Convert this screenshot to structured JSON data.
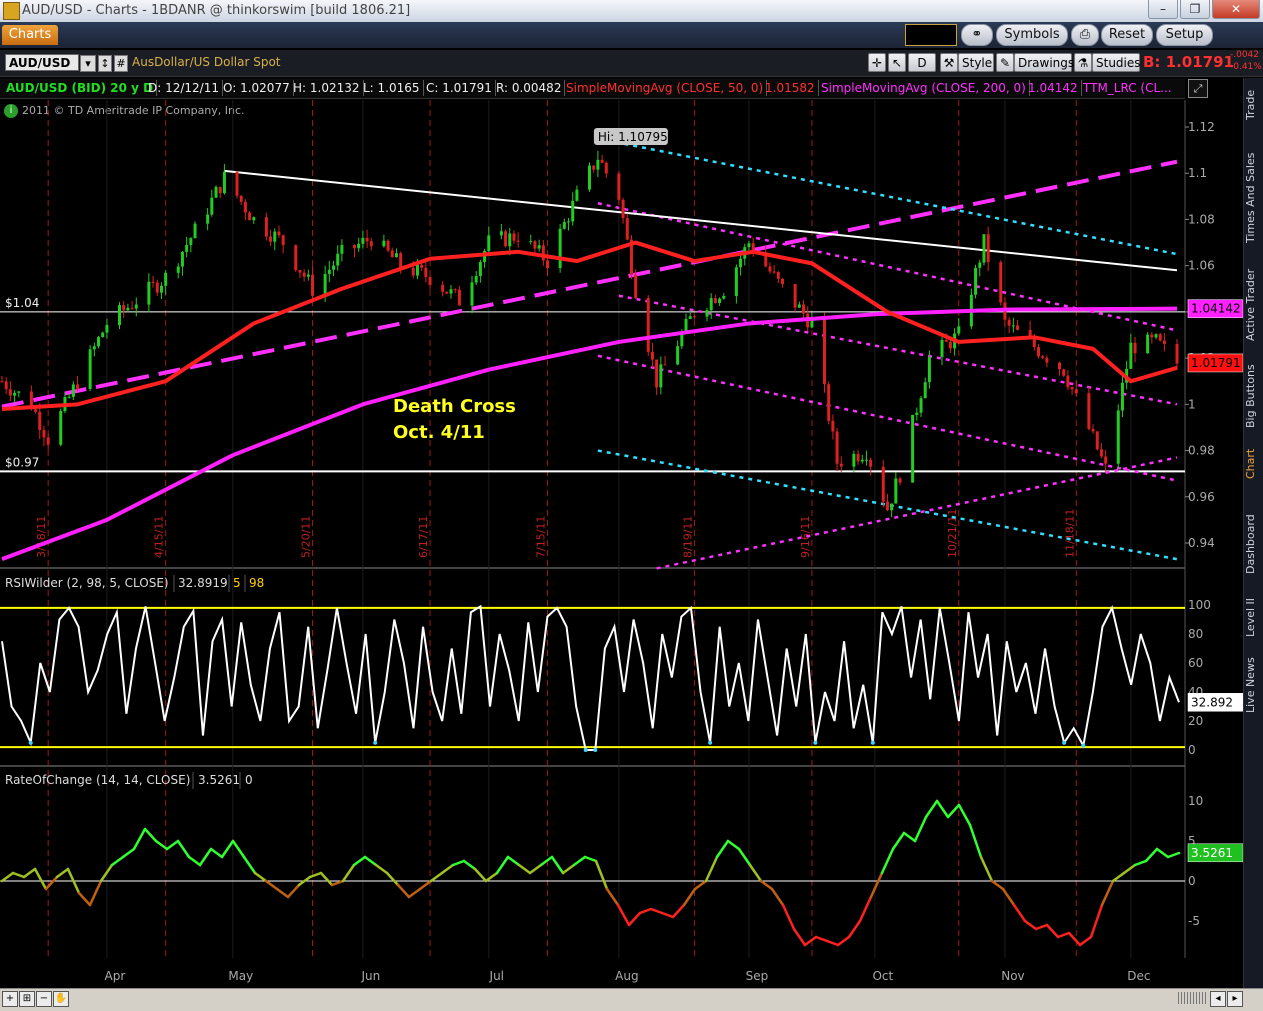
{
  "window": {
    "title": "AUD/USD - Charts - 1BDANR @ thinkorswim [build 1806.21]",
    "min_label": "–",
    "restore_label": "❐",
    "close_label": "✕"
  },
  "toolbar": {
    "tab_label": "Charts",
    "symbols_label": "Symbols",
    "reset_label": "Reset",
    "setup_label": "Setup"
  },
  "symbolbar": {
    "symbol": "AUD/USD",
    "description": "AusDollar/US Dollar Spot",
    "aggregation_label": "D",
    "style_label": "Style",
    "drawings_label": "Drawings",
    "studies_label": "Studies",
    "bid_label": "B: 1.01791",
    "change_abs": "-.0042",
    "change_pct": "-0.41%"
  },
  "infobar": {
    "symbol_period": "AUD/USD (BID) 20 y D",
    "date": "D: 12/12/11",
    "open": "O: 1.02077",
    "high": "H: 1.02132",
    "low": "L: 1.0165",
    "close": "C: 1.01791",
    "range": "R: 0.00482",
    "sma50": "SimpleMovingAvg (CLOSE, 50, 0)",
    "sma50_val": "1.01582",
    "sma200": "SimpleMovingAvg (CLOSE, 200, 0)",
    "sma200_val": "1.04142",
    "lrc": "TTM_LRC (CL..."
  },
  "copyright": "2011 © TD Ameritrade IP Company, Inc.",
  "sidebar_tabs": [
    "Trade",
    "Times And Sales",
    "Active Trader",
    "Big Buttons",
    "Chart",
    "Dashboard",
    "Level II",
    "Live News"
  ],
  "colors": {
    "price_up": "#22cc22",
    "price_down": "#dd2020",
    "sma50": "#ff2020",
    "sma200": "#ff20ff",
    "lrc_inner": "#ff30ff",
    "lrc_outer": "#30e0ff",
    "rsi": "#ffffff",
    "level_line": "#ffff00"
  },
  "chart_data": [
    {
      "type": "candlestick",
      "title": "AUD/USD (BID) 20 y D",
      "ylim": [
        0.93,
        1.125
      ],
      "y_ticks": [
        "1.12",
        "1.1",
        "1.08",
        "1.06",
        "1.04",
        "1.02",
        "1",
        "0.98",
        "0.96",
        "0.94"
      ],
      "x_months": [
        "Apr",
        "May",
        "Jun",
        "Jul",
        "Aug",
        "Sep",
        "Oct",
        "Nov",
        "Dec"
      ],
      "date_markers": [
        "3/18/11",
        "4/15/11",
        "5/20/11",
        "6/17/11",
        "7/15/11",
        "8/19/11",
        "9/16/11",
        "10/21/11",
        "11/18/11"
      ],
      "close_path": [
        {
          "t": "2011-03-07",
          "v": 1.01
        },
        {
          "t": "2011-03-14",
          "v": 1.0
        },
        {
          "t": "2011-03-18",
          "v": 0.985
        },
        {
          "t": "2011-03-25",
          "v": 1.01
        },
        {
          "t": "2011-04-01",
          "v": 1.035
        },
        {
          "t": "2011-04-08",
          "v": 1.045
        },
        {
          "t": "2011-04-15",
          "v": 1.055
        },
        {
          "t": "2011-04-22",
          "v": 1.075
        },
        {
          "t": "2011-04-29",
          "v": 1.098
        },
        {
          "t": "2011-05-06",
          "v": 1.08
        },
        {
          "t": "2011-05-13",
          "v": 1.07
        },
        {
          "t": "2011-05-20",
          "v": 1.05
        },
        {
          "t": "2011-05-27",
          "v": 1.065
        },
        {
          "t": "2011-06-03",
          "v": 1.072
        },
        {
          "t": "2011-06-10",
          "v": 1.06
        },
        {
          "t": "2011-06-17",
          "v": 1.055
        },
        {
          "t": "2011-06-24",
          "v": 1.045
        },
        {
          "t": "2011-07-01",
          "v": 1.07
        },
        {
          "t": "2011-07-08",
          "v": 1.073
        },
        {
          "t": "2011-07-15",
          "v": 1.062
        },
        {
          "t": "2011-07-22",
          "v": 1.09
        },
        {
          "t": "2011-07-27",
          "v": 1.107
        },
        {
          "t": "2011-08-01",
          "v": 1.09
        },
        {
          "t": "2011-08-05",
          "v": 1.05
        },
        {
          "t": "2011-08-10",
          "v": 1.01
        },
        {
          "t": "2011-08-19",
          "v": 1.04
        },
        {
          "t": "2011-08-26",
          "v": 1.05
        },
        {
          "t": "2011-09-01",
          "v": 1.07
        },
        {
          "t": "2011-09-09",
          "v": 1.05
        },
        {
          "t": "2011-09-16",
          "v": 1.035
        },
        {
          "t": "2011-09-22",
          "v": 0.975
        },
        {
          "t": "2011-09-29",
          "v": 0.98
        },
        {
          "t": "2011-10-04",
          "v": 0.955
        },
        {
          "t": "2011-10-07",
          "v": 0.97
        },
        {
          "t": "2011-10-14",
          "v": 1.02
        },
        {
          "t": "2011-10-21",
          "v": 1.03
        },
        {
          "t": "2011-10-27",
          "v": 1.07
        },
        {
          "t": "2011-11-01",
          "v": 1.035
        },
        {
          "t": "2011-11-08",
          "v": 1.025
        },
        {
          "t": "2011-11-15",
          "v": 1.015
        },
        {
          "t": "2011-11-22",
          "v": 0.985
        },
        {
          "t": "2011-11-25",
          "v": 0.972
        },
        {
          "t": "2011-12-01",
          "v": 1.025
        },
        {
          "t": "2011-12-07",
          "v": 1.027
        },
        {
          "t": "2011-12-12",
          "v": 1.0179
        }
      ],
      "sma50": [
        {
          "t": "2011-03-07",
          "v": 0.998
        },
        {
          "t": "2011-03-25",
          "v": 1.0
        },
        {
          "t": "2011-04-15",
          "v": 1.01
        },
        {
          "t": "2011-05-06",
          "v": 1.035
        },
        {
          "t": "2011-05-27",
          "v": 1.05
        },
        {
          "t": "2011-06-17",
          "v": 1.063
        },
        {
          "t": "2011-07-08",
          "v": 1.066
        },
        {
          "t": "2011-07-22",
          "v": 1.062
        },
        {
          "t": "2011-08-05",
          "v": 1.07
        },
        {
          "t": "2011-08-19",
          "v": 1.062
        },
        {
          "t": "2011-09-02",
          "v": 1.066
        },
        {
          "t": "2011-09-16",
          "v": 1.061
        },
        {
          "t": "2011-10-04",
          "v": 1.04
        },
        {
          "t": "2011-10-21",
          "v": 1.027
        },
        {
          "t": "2011-11-08",
          "v": 1.029
        },
        {
          "t": "2011-11-22",
          "v": 1.024
        },
        {
          "t": "2011-12-01",
          "v": 1.01
        },
        {
          "t": "2011-12-12",
          "v": 1.0158
        }
      ],
      "sma200": [
        {
          "t": "2011-03-07",
          "v": 0.933
        },
        {
          "t": "2011-04-01",
          "v": 0.95
        },
        {
          "t": "2011-05-01",
          "v": 0.978
        },
        {
          "t": "2011-06-01",
          "v": 1.0
        },
        {
          "t": "2011-07-01",
          "v": 1.015
        },
        {
          "t": "2011-08-01",
          "v": 1.027
        },
        {
          "t": "2011-09-01",
          "v": 1.035
        },
        {
          "t": "2011-10-01",
          "v": 1.039
        },
        {
          "t": "2011-11-01",
          "v": 1.041
        },
        {
          "t": "2011-12-12",
          "v": 1.0414
        }
      ],
      "trendline_high": [
        {
          "t": "2011-04-29",
          "v": 1.101
        },
        {
          "t": "2011-12-12",
          "v": 1.058
        }
      ],
      "horizontal_levels": [
        {
          "label": "$1.04",
          "v": 1.04
        },
        {
          "label": "$0.97",
          "v": 0.971
        }
      ],
      "channel_lines": [
        {
          "style": "thick-dash",
          "color": "magenta",
          "from": {
            "t": "2011-03-07",
            "v": 0.999
          },
          "to": {
            "t": "2011-12-12",
            "v": 1.105
          }
        },
        {
          "style": "dash",
          "color": "cyan",
          "from": {
            "t": "2011-07-27",
            "v": 1.115
          },
          "to": {
            "t": "2011-12-12",
            "v": 1.065
          }
        },
        {
          "style": "dash",
          "color": "magenta",
          "from": {
            "t": "2011-07-27",
            "v": 1.087
          },
          "to": {
            "t": "2011-12-12",
            "v": 1.032
          }
        },
        {
          "style": "dash",
          "color": "magenta",
          "from": {
            "t": "2011-08-01",
            "v": 1.047
          },
          "to": {
            "t": "2011-12-12",
            "v": 1.0
          }
        },
        {
          "style": "dash",
          "color": "magenta",
          "from": {
            "t": "2011-07-27",
            "v": 1.021
          },
          "to": {
            "t": "2011-12-12",
            "v": 0.967
          }
        },
        {
          "style": "dash",
          "color": "cyan",
          "from": {
            "t": "2011-07-27",
            "v": 0.98
          },
          "to": {
            "t": "2011-12-12",
            "v": 0.933
          }
        },
        {
          "style": "dash",
          "color": "magenta",
          "from": {
            "t": "2011-08-10",
            "v": 0.929
          },
          "to": {
            "t": "2011-12-12",
            "v": 0.977
          }
        }
      ],
      "annotations": {
        "high_label": "Hi: 1.10795",
        "death_cross_line1": "Death Cross",
        "death_cross_line2": "Oct. 4/11"
      },
      "last_values": {
        "sma200": "1.04142",
        "close": "1.01791"
      }
    },
    {
      "type": "line",
      "title": "RSIWilder (2, 98, 5, CLOSE)",
      "value_label": "32.8919",
      "input1": "5",
      "input2": "98",
      "ylim": [
        -2,
        102
      ],
      "y_ticks": [
        "100",
        "80",
        "60",
        "40",
        "20",
        "0"
      ],
      "levels": [
        98,
        2
      ],
      "last_value": "32.892",
      "values": [
        75,
        30,
        20,
        5,
        60,
        40,
        90,
        98,
        85,
        40,
        55,
        80,
        95,
        25,
        70,
        99,
        60,
        20,
        50,
        85,
        96,
        10,
        75,
        90,
        30,
        88,
        45,
        20,
        70,
        95,
        20,
        30,
        85,
        15,
        55,
        98,
        60,
        25,
        80,
        5,
        40,
        90,
        60,
        15,
        85,
        40,
        20,
        70,
        25,
        95,
        99,
        30,
        80,
        55,
        20,
        88,
        40,
        92,
        98,
        85,
        30,
        0,
        0,
        70,
        85,
        40,
        90,
        60,
        15,
        80,
        50,
        92,
        98,
        40,
        5,
        85,
        30,
        60,
        20,
        90,
        50,
        10,
        70,
        30,
        80,
        5,
        40,
        20,
        75,
        15,
        45,
        5,
        95,
        80,
        99,
        50,
        90,
        35,
        98,
        60,
        20,
        95,
        50,
        80,
        10,
        75,
        40,
        60,
        25,
        70,
        30,
        5,
        15,
        3,
        40,
        85,
        98,
        70,
        45,
        80,
        60,
        20,
        50,
        32.9
      ]
    },
    {
      "type": "line",
      "title": "RateOfChange (14, 14, CLOSE)",
      "value_label": "3.5261",
      "input1": "0",
      "ylim": [
        -8.5,
        10.5
      ],
      "y_ticks": [
        "10",
        "5",
        "0",
        "-5"
      ],
      "last_value": "3.5261",
      "values": [
        0,
        1,
        0.5,
        1.5,
        -1,
        0.5,
        1.5,
        -1.5,
        -3,
        0,
        2,
        3,
        4,
        6.5,
        5,
        4,
        5,
        3,
        2,
        4,
        3,
        5,
        3,
        1,
        0,
        -1,
        -2,
        -0.5,
        0.5,
        1,
        -0.5,
        0,
        2,
        3,
        2,
        1,
        -0.5,
        -2,
        -1,
        0,
        1,
        2,
        2.5,
        1.5,
        0,
        1,
        3,
        2,
        1,
        2,
        3,
        1,
        2,
        3,
        2.5,
        -1,
        -3,
        -5.5,
        -4,
        -3.5,
        -4,
        -4.5,
        -3,
        -1,
        0,
        3,
        5,
        4,
        2,
        0,
        -1,
        -3,
        -6,
        -8,
        -7,
        -7.5,
        -8,
        -7,
        -5,
        -2,
        1,
        4,
        6,
        5,
        8,
        10,
        8,
        9.5,
        7,
        3,
        0,
        -1,
        -3,
        -5,
        -6,
        -5.5,
        -7,
        -6.5,
        -8,
        -7,
        -3,
        0,
        1,
        2,
        2.5,
        4,
        3,
        3.5
      ]
    }
  ]
}
